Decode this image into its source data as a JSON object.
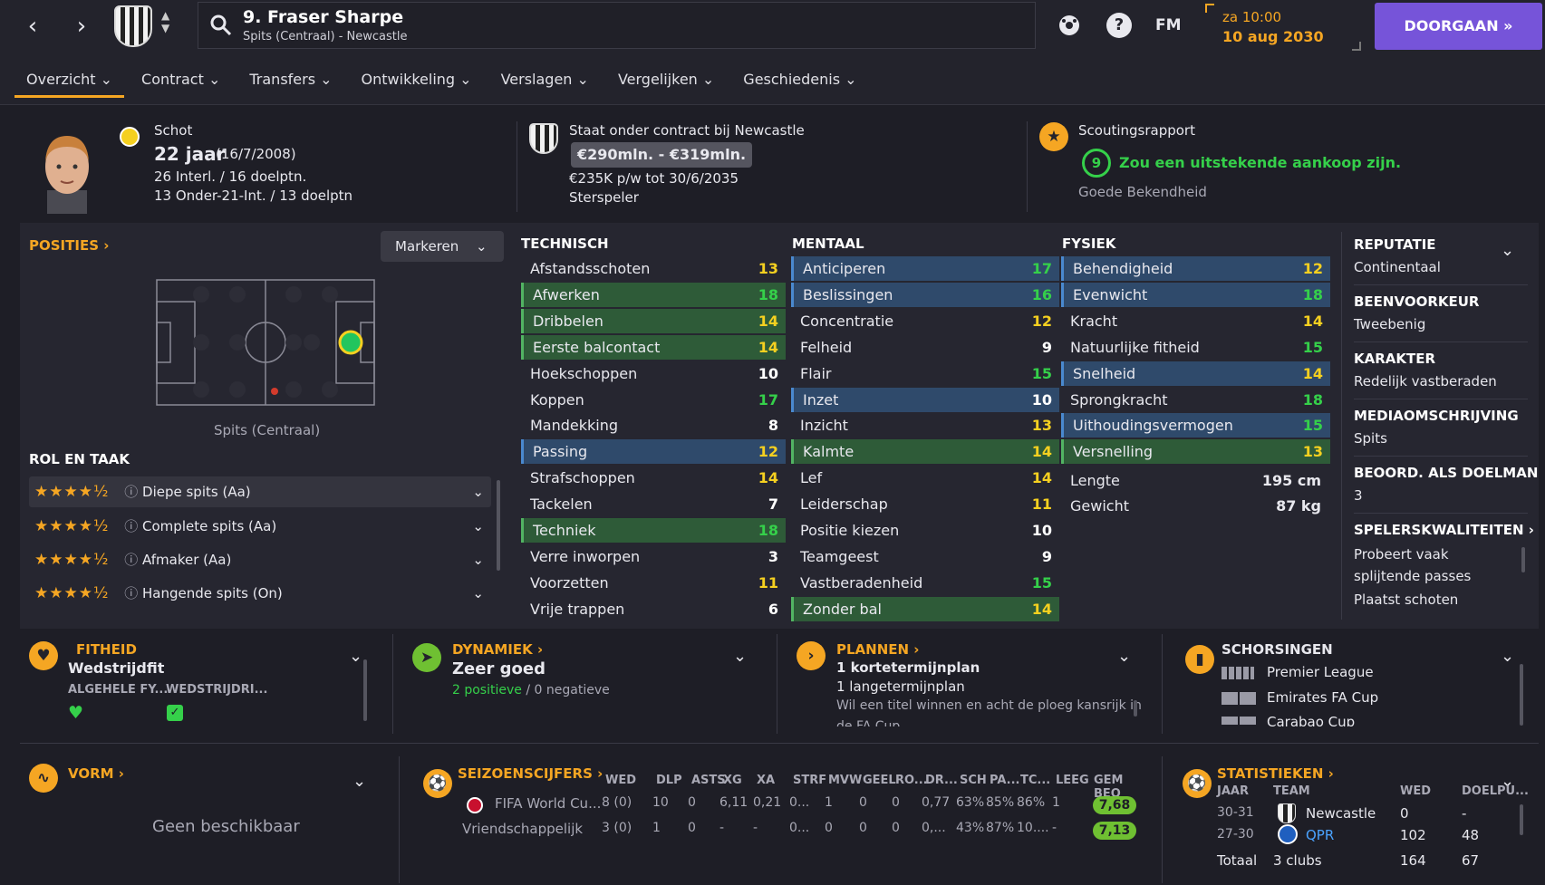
{
  "header": {
    "player_title": "9. Fraser Sharpe",
    "player_subtitle": "Spits (Centraal) - Newcastle",
    "fm_label": "FM",
    "help_glyph": "?",
    "time": "za 10:00",
    "date": "10 aug 2030",
    "continue_label": "DOORGAAN",
    "icons": [
      "back-arrow-icon",
      "forward-arrow-icon",
      "search-icon",
      "football-icon",
      "help-icon",
      "fast-forward-icon"
    ]
  },
  "tabs": [
    "Overzicht",
    "Contract",
    "Transfers",
    "Ontwikkeling",
    "Verslagen",
    "Vergelijken",
    "Geschiedenis"
  ],
  "profile": {
    "label": "Schot",
    "age": "22 jaar",
    "dob": "(16/7/2008)",
    "caps": "26 Interl. / 16 doelptn.",
    "u21_caps": "13 Onder-21-Int. / 13 doelptn"
  },
  "contract": {
    "label": "Staat onder contract bij Newcastle",
    "value": "€290mln. - €319mln.",
    "wage": "€235K p/w tot 30/6/2035",
    "status": "Sterspeler"
  },
  "scouting": {
    "label": "Scoutingsrapport",
    "score": "9",
    "verdict": "Zou een uitstekende aankoop zijn.",
    "familiarity": "Goede Bekendheid",
    "icon_glyph": "★"
  },
  "positions": {
    "title": "POSITIES",
    "mark_button": "Markeren",
    "position_label": "Spits (Centraal)"
  },
  "roles": {
    "title": "ROL EN TAAK",
    "items": [
      {
        "stars": "★★★★½",
        "label": "Diepe spits (Aa)"
      },
      {
        "stars": "★★★★½",
        "label": "Complete spits (Aa)"
      },
      {
        "stars": "★★★★½",
        "label": "Afmaker (Aa)"
      },
      {
        "stars": "★★★★½",
        "label": "Hangende spits (On)"
      }
    ]
  },
  "technical": {
    "title": "TECHNISCH",
    "rows": [
      {
        "name": "Afstandsschoten",
        "value": "13",
        "hl": ""
      },
      {
        "name": "Afwerken",
        "value": "18",
        "hl": "green"
      },
      {
        "name": "Dribbelen",
        "value": "14",
        "hl": "green"
      },
      {
        "name": "Eerste balcontact",
        "value": "14",
        "hl": "green"
      },
      {
        "name": "Hoekschoppen",
        "value": "10",
        "hl": ""
      },
      {
        "name": "Koppen",
        "value": "17",
        "hl": ""
      },
      {
        "name": "Mandekking",
        "value": "8",
        "hl": ""
      },
      {
        "name": "Passing",
        "value": "12",
        "hl": "blue"
      },
      {
        "name": "Strafschoppen",
        "value": "14",
        "hl": ""
      },
      {
        "name": "Tackelen",
        "value": "7",
        "hl": ""
      },
      {
        "name": "Techniek",
        "value": "18",
        "hl": "green"
      },
      {
        "name": "Verre inworpen",
        "value": "3",
        "hl": ""
      },
      {
        "name": "Voorzetten",
        "value": "11",
        "hl": ""
      },
      {
        "name": "Vrije trappen",
        "value": "6",
        "hl": ""
      }
    ]
  },
  "mental": {
    "title": "MENTAAL",
    "rows": [
      {
        "name": "Anticiperen",
        "value": "17",
        "hl": "blue"
      },
      {
        "name": "Beslissingen",
        "value": "16",
        "hl": "blue"
      },
      {
        "name": "Concentratie",
        "value": "12",
        "hl": ""
      },
      {
        "name": "Felheid",
        "value": "9",
        "hl": ""
      },
      {
        "name": "Flair",
        "value": "15",
        "hl": ""
      },
      {
        "name": "Inzet",
        "value": "10",
        "hl": "blue"
      },
      {
        "name": "Inzicht",
        "value": "13",
        "hl": ""
      },
      {
        "name": "Kalmte",
        "value": "14",
        "hl": "green"
      },
      {
        "name": "Lef",
        "value": "14",
        "hl": ""
      },
      {
        "name": "Leiderschap",
        "value": "11",
        "hl": ""
      },
      {
        "name": "Positie kiezen",
        "value": "10",
        "hl": ""
      },
      {
        "name": "Teamgeest",
        "value": "9",
        "hl": ""
      },
      {
        "name": "Vastberadenheid",
        "value": "15",
        "hl": ""
      },
      {
        "name": "Zonder bal",
        "value": "14",
        "hl": "green"
      }
    ]
  },
  "physical": {
    "title": "FYSIEK",
    "rows": [
      {
        "name": "Behendigheid",
        "value": "12",
        "hl": "blue"
      },
      {
        "name": "Evenwicht",
        "value": "18",
        "hl": "blue"
      },
      {
        "name": "Kracht",
        "value": "14",
        "hl": ""
      },
      {
        "name": "Natuurlijke fitheid",
        "value": "15",
        "hl": ""
      },
      {
        "name": "Snelheid",
        "value": "14",
        "hl": "blue"
      },
      {
        "name": "Sprongkracht",
        "value": "18",
        "hl": ""
      },
      {
        "name": "Uithoudingsvermogen",
        "value": "15",
        "hl": "blue"
      },
      {
        "name": "Versnelling",
        "value": "13",
        "hl": "green"
      }
    ],
    "height_label": "Lengte",
    "height": "195 cm",
    "weight_label": "Gewicht",
    "weight": "87 kg"
  },
  "sidebar": {
    "reputation_title": "REPUTATIE",
    "reputation": "Continentaal",
    "foot_title": "BEENVOORKEUR",
    "foot": "Tweebenig",
    "character_title": "KARAKTER",
    "character": "Redelijk vastberaden",
    "media_title": "MEDIAOMSCHRIJVING",
    "media": "Spits",
    "gk_title": "BEOORD. ALS DOELMAN",
    "gk": "3",
    "traits_title": "SPELERSKWALITEITEN",
    "traits": [
      "Probeert vaak",
      "splijtende passes",
      "Plaatst schoten"
    ]
  },
  "fitness": {
    "title": "FITHEID",
    "value": "Wedstrijdfit",
    "col1": "ALGEHELE FY...",
    "col2": "WEDSTRIJDRI..."
  },
  "dynamics": {
    "title": "DYNAMIEK",
    "value": "Zeer goed",
    "positive": "2 positieve",
    "sep": "/",
    "negative": "0 negatieve"
  },
  "plans": {
    "title": "PLANNEN",
    "line1": "1 kortetermijnplan",
    "line2": "1 langetermijnplan",
    "line3": "Wil een titel winnen en acht de ploeg kansrijk in",
    "line4": "de FA Cup"
  },
  "suspensions": {
    "title": "SCHORSINGEN",
    "items": [
      "Premier League",
      "Emirates FA Cup",
      "Carabao Cup"
    ]
  },
  "form": {
    "title": "VORM",
    "empty": "Geen beschikbaar"
  },
  "season_stats": {
    "title": "SEIZOENSCIJFERS",
    "headers": [
      "WED",
      "DLP",
      "ASTS",
      "XG",
      "XA",
      "STRF",
      "MVW",
      "GEEL",
      "RO...",
      "DR...",
      "SCH",
      "PA...",
      "TC...",
      "LEEG",
      "GEM BEO"
    ],
    "rows": [
      {
        "comp": "FIFA World Cu...",
        "cells": [
          "8 (0)",
          "10",
          "0",
          "6,11",
          "0,21",
          "0...",
          "1",
          "0",
          "0",
          "0,77",
          "63%",
          "85%",
          "86%",
          "1"
        ],
        "rating": "7,68"
      },
      {
        "comp": "Vriendschappelijk",
        "cells": [
          "3 (0)",
          "1",
          "0",
          "-",
          "-",
          "0...",
          "0",
          "0",
          "0",
          "0,...",
          "43%",
          "87%",
          "10....",
          "-"
        ],
        "rating": "7,13"
      }
    ]
  },
  "career_stats": {
    "title": "STATISTIEKEN",
    "headers": [
      "JAAR",
      "TEAM",
      "WED",
      "DOELPU..."
    ],
    "rows": [
      {
        "year": "30-31",
        "team": "Newcastle",
        "apps": "0",
        "goals": "-"
      },
      {
        "year": "27-30",
        "team": "QPR",
        "apps": "102",
        "goals": "48"
      }
    ],
    "total_label": "Totaal",
    "total_team": "3 clubs",
    "total_apps": "164",
    "total_goals": "67"
  },
  "colors": {
    "accent": "#f5a623",
    "continue": "#7654d9",
    "green_highlight": "#2e5b38",
    "blue_highlight": "#2f4a6b",
    "positive": "#35d04a"
  }
}
